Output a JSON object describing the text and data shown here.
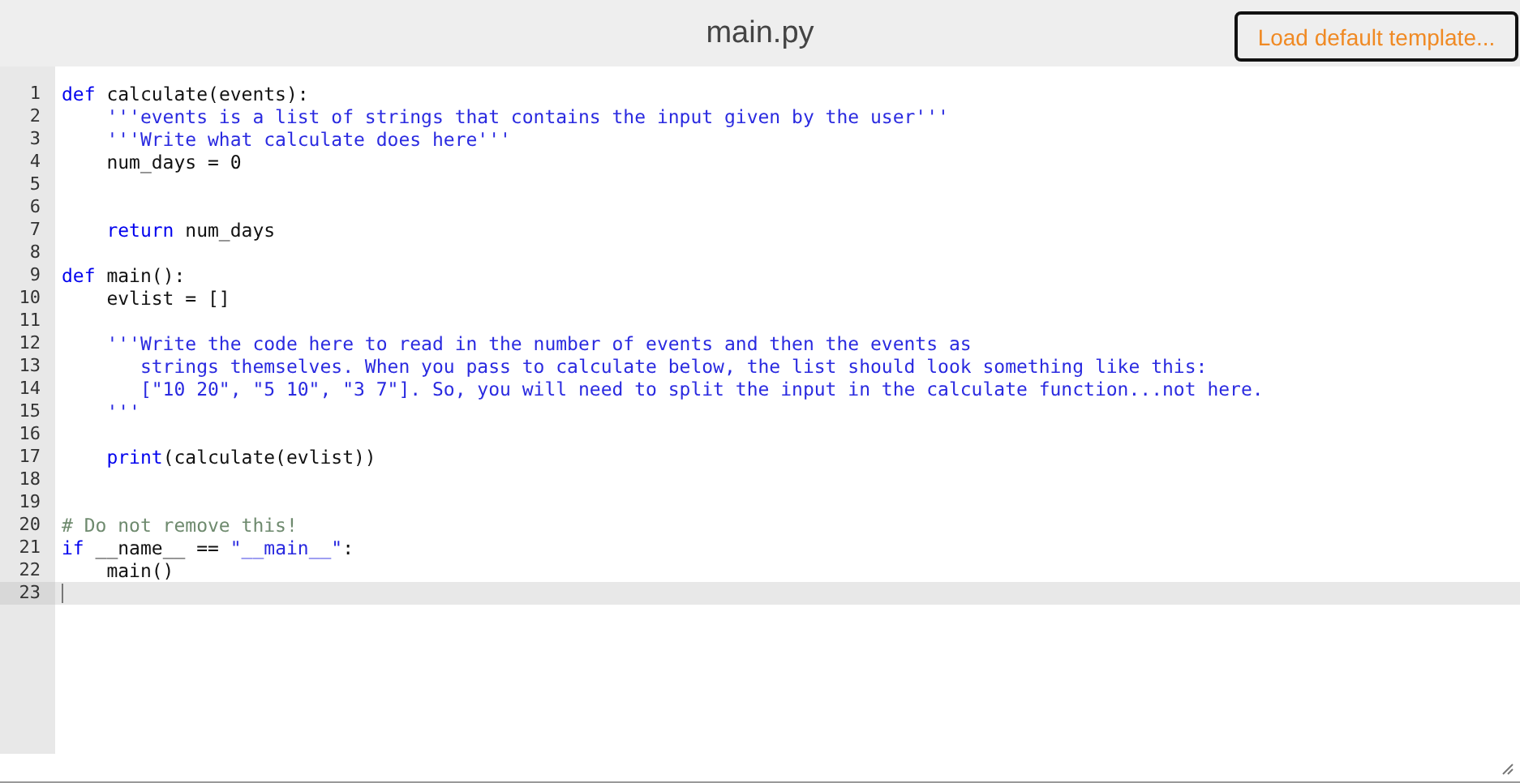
{
  "header": {
    "title": "main.py",
    "button": "Load default template..."
  },
  "editor": {
    "lines": [
      {
        "number": "1",
        "active": false,
        "kind": "top",
        "tokens": [
          {
            "kind": "keyword",
            "text": "def"
          },
          {
            "kind": "plain",
            "text": " calculate(events):"
          }
        ]
      },
      {
        "number": "2",
        "active": false,
        "kind": "body",
        "tokens": [
          {
            "kind": "string",
            "text": "'''events is a list of strings that contains the input given by the user'''"
          }
        ]
      },
      {
        "number": "3",
        "active": false,
        "kind": "body",
        "tokens": [
          {
            "kind": "string",
            "text": "'''Write what calculate does here'''"
          }
        ]
      },
      {
        "number": "4",
        "active": false,
        "kind": "body",
        "tokens": [
          {
            "kind": "plain",
            "text": "num_days = 0"
          }
        ]
      },
      {
        "number": "5",
        "active": false,
        "kind": "top"
      },
      {
        "number": "6",
        "active": false,
        "kind": "top"
      },
      {
        "number": "7",
        "active": false,
        "kind": "body",
        "tokens": [
          {
            "kind": "keyword",
            "text": "return"
          },
          {
            "kind": "plain",
            "text": " num_days"
          }
        ]
      },
      {
        "number": "8",
        "active": false,
        "kind": "top"
      },
      {
        "number": "9",
        "active": false,
        "kind": "top",
        "tokens": [
          {
            "kind": "keyword",
            "text": "def"
          },
          {
            "kind": "plain",
            "text": " main():"
          }
        ]
      },
      {
        "number": "10",
        "active": false,
        "kind": "body",
        "tokens": [
          {
            "kind": "plain",
            "text": "evlist = []"
          }
        ]
      },
      {
        "number": "11",
        "active": false,
        "kind": "top"
      },
      {
        "number": "12",
        "active": false,
        "kind": "body",
        "tokens": [
          {
            "kind": "string",
            "text": "'''Write the code here to read in the number of events and then the events as"
          }
        ]
      },
      {
        "number": "13",
        "active": false,
        "kind": "continuation",
        "tokens": [
          {
            "kind": "string",
            "text": "strings themselves. When you pass to calculate below, the list should look something like this:"
          }
        ]
      },
      {
        "number": "14",
        "active": false,
        "kind": "continuation",
        "tokens": [
          {
            "kind": "string",
            "text": "[\"10 20\", \"5 10\", \"3 7\"]. So, you will need to split the input in the calculate function...not here."
          }
        ]
      },
      {
        "number": "15",
        "active": false,
        "kind": "body",
        "tokens": [
          {
            "kind": "string",
            "text": "'''"
          }
        ]
      },
      {
        "number": "16",
        "active": false,
        "kind": "top"
      },
      {
        "number": "17",
        "active": false,
        "kind": "body",
        "tokens": [
          {
            "kind": "keyword",
            "text": "print"
          },
          {
            "kind": "plain",
            "text": "(calculate(evlist))"
          }
        ]
      },
      {
        "number": "18",
        "active": false,
        "kind": "top"
      },
      {
        "number": "19",
        "active": false,
        "kind": "top"
      },
      {
        "number": "20",
        "active": false,
        "kind": "top",
        "tokens": [
          {
            "kind": "comment",
            "text": "# Do not remove this!"
          }
        ]
      },
      {
        "number": "21",
        "active": false,
        "kind": "top",
        "tokens": [
          {
            "kind": "keyword",
            "text": "if"
          },
          {
            "kind": "plain",
            "text": " __name__ == "
          },
          {
            "kind": "string",
            "text": "\"__main__\""
          },
          {
            "kind": "plain",
            "text": ":"
          }
        ]
      },
      {
        "number": "22",
        "active": false,
        "kind": "body",
        "tokens": [
          {
            "kind": "plain",
            "text": "main()"
          }
        ]
      },
      {
        "number": "23",
        "active": true,
        "kind": "top"
      }
    ]
  }
}
